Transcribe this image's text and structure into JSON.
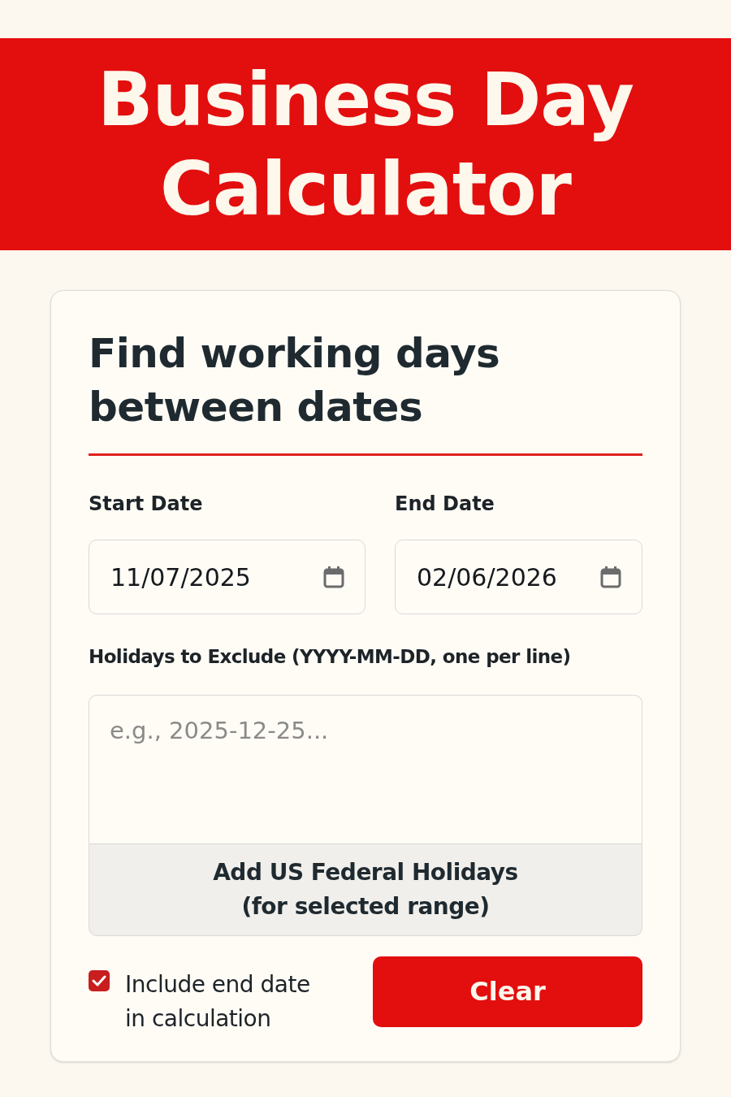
{
  "header": {
    "title": "Business Day Calculator"
  },
  "card": {
    "heading": "Find working days between dates",
    "start_date": {
      "label": "Start Date",
      "value": "11/07/2025"
    },
    "end_date": {
      "label": "End Date",
      "value": "02/06/2026"
    },
    "holidays": {
      "label": "Holidays to Exclude (YYYY-MM-DD, one per line)",
      "placeholder": "e.g., 2025-12-25..."
    },
    "add_holidays_button": "Add US Federal Holidays (for selected range)",
    "include_end_date": {
      "label": "Include end date in calculation",
      "checked": true
    },
    "clear_button": "Clear"
  }
}
